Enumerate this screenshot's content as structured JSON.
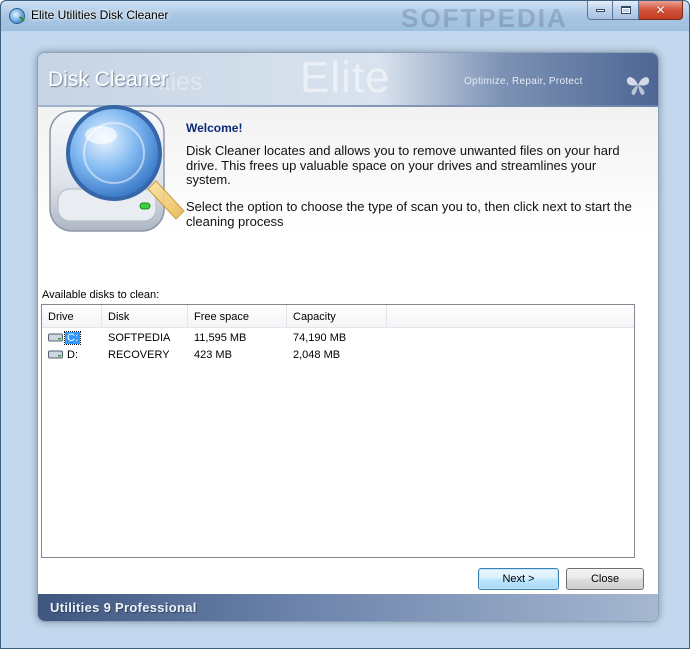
{
  "window": {
    "title": "Elite Utilities Disk Cleaner",
    "watermark": "SOFTPEDIA",
    "close_glyph": "✕"
  },
  "banner": {
    "title": "Disk Cleaner",
    "ghost": "ities",
    "brand": "Elite",
    "tagline": "Optimize, Repair, Protect"
  },
  "welcome": {
    "title": "Welcome!",
    "paragraph1": "Disk Cleaner locates and allows you to remove unwanted files on your hard drive. This frees up valuable space on your drives and streamlines your system.",
    "paragraph2": "Select the option to choose the type of scan you to, then click next to start the cleaning process"
  },
  "disks": {
    "label": "Available disks to clean:",
    "columns": {
      "drive": "Drive",
      "disk": "Disk",
      "free": "Free space",
      "capacity": "Capacity"
    },
    "rows": [
      {
        "drive": "C:",
        "disk": "SOFTPEDIA",
        "free": "11,595 MB",
        "capacity": "74,190 MB"
      },
      {
        "drive": "D:",
        "disk": "RECOVERY",
        "free": "423 MB",
        "capacity": "2,048 MB"
      }
    ]
  },
  "buttons": {
    "next": "Next >",
    "close": "Close"
  },
  "footer": {
    "product": "Utilities 9 Professional"
  }
}
